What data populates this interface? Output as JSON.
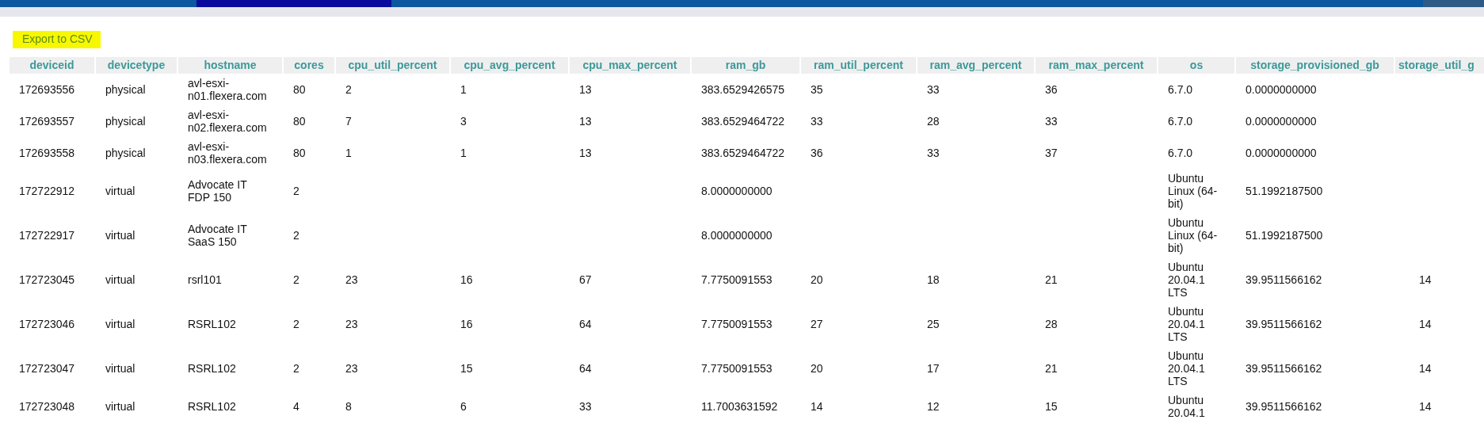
{
  "export_link": {
    "label": "Export to CSV"
  },
  "table": {
    "columns": [
      "deviceid",
      "devicetype",
      "hostname",
      "cores",
      "cpu_util_percent",
      "cpu_avg_percent",
      "cpu_max_percent",
      "ram_gb",
      "ram_util_percent",
      "ram_avg_percent",
      "ram_max_percent",
      "os",
      "storage_provisioned_gb",
      "storage_util_g"
    ],
    "rows": [
      [
        "172693556",
        "physical",
        "avl-esxi-n01.flexera.com",
        "80",
        "2",
        "1",
        "13",
        "383.6529426575",
        "35",
        "33",
        "36",
        "6.7.0",
        "0.0000000000",
        null
      ],
      [
        "172693557",
        "physical",
        "avl-esxi-n02.flexera.com",
        "80",
        "7",
        "3",
        "13",
        "383.6529464722",
        "33",
        "28",
        "33",
        "6.7.0",
        "0.0000000000",
        null
      ],
      [
        "172693558",
        "physical",
        "avl-esxi-n03.flexera.com",
        "80",
        "1",
        "1",
        "13",
        "383.6529464722",
        "36",
        "33",
        "37",
        "6.7.0",
        "0.0000000000",
        null
      ],
      [
        "172722912",
        "virtual",
        "Advocate IT FDP 150",
        "2",
        null,
        null,
        null,
        "8.0000000000",
        null,
        null,
        null,
        "Ubuntu Linux (64-bit)",
        "51.1992187500",
        null
      ],
      [
        "172722917",
        "virtual",
        "Advocate IT SaaS 150",
        "2",
        null,
        null,
        null,
        "8.0000000000",
        null,
        null,
        null,
        "Ubuntu Linux (64-bit)",
        "51.1992187500",
        null
      ],
      [
        "172723045",
        "virtual",
        "rsrl101",
        "2",
        "23",
        "16",
        "67",
        "7.7750091553",
        "20",
        "18",
        "21",
        "Ubuntu 20.04.1 LTS",
        "39.9511566162",
        "14"
      ],
      [
        "172723046",
        "virtual",
        "RSRL102",
        "2",
        "23",
        "16",
        "64",
        "7.7750091553",
        "27",
        "25",
        "28",
        "Ubuntu 20.04.1 LTS",
        "39.9511566162",
        "14"
      ],
      [
        "172723047",
        "virtual",
        "RSRL102",
        "2",
        "23",
        "15",
        "64",
        "7.7750091553",
        "20",
        "17",
        "21",
        "Ubuntu 20.04.1 LTS",
        "39.9511566162",
        "14"
      ],
      [
        "172723048",
        "virtual",
        "RSRL102",
        "4",
        "8",
        "6",
        "33",
        "11.7003631592",
        "14",
        "12",
        "15",
        "Ubuntu 20.04.1",
        "39.9511566162",
        "14"
      ]
    ]
  }
}
